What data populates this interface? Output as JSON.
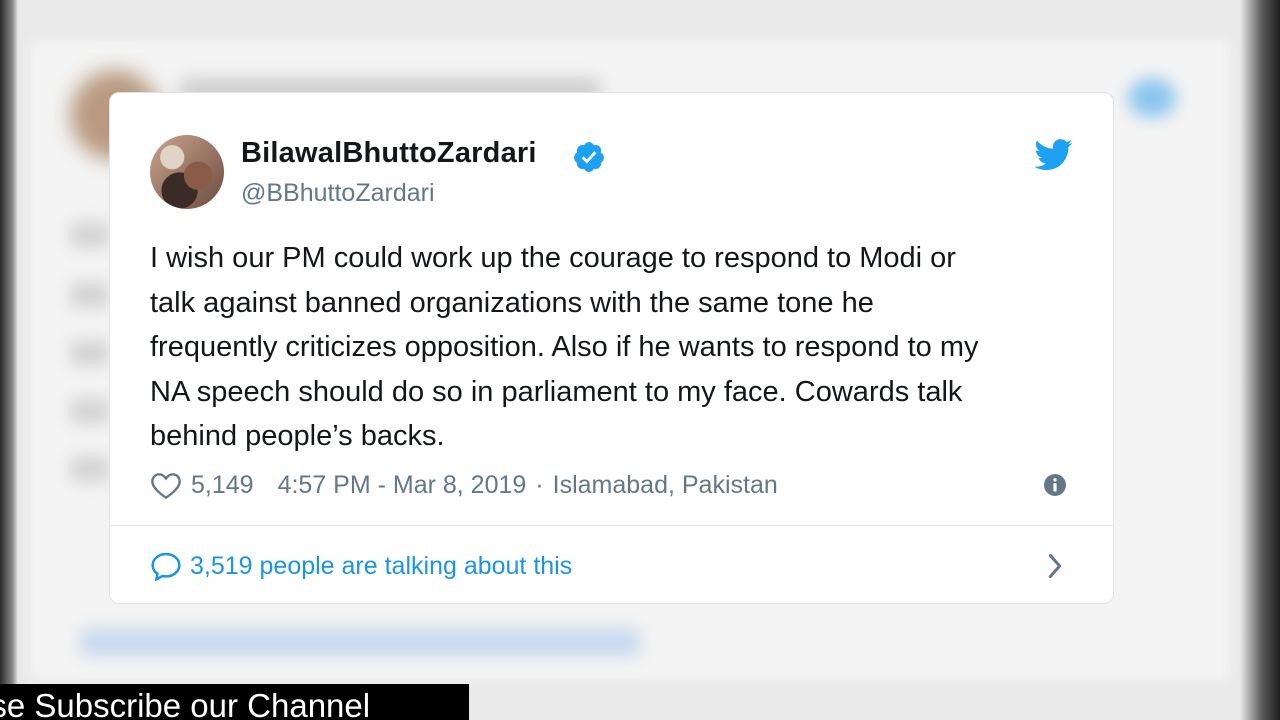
{
  "tweet": {
    "display_name": "BilawalBhuttoZardari",
    "handle": "@BBhuttoZardari",
    "verified_icon": "verified-badge-icon",
    "brand_icon": "twitter-bird-icon",
    "text_lines": [
      "I wish our PM could work up the courage to respond to Modi or",
      "talk against banned organizations with the same tone he",
      "frequently criticizes opposition. Also if he wants to respond to my",
      "NA speech should do so in parliament to my face. Cowards talk",
      "behind people’s backs."
    ],
    "likes": "5,149",
    "timestamp": "4:57 PM - Mar 8, 2019",
    "separator": "·",
    "location": "Islamabad, Pakistan",
    "talking": "3,519 people are talking about this"
  },
  "banner": {
    "text": "ase Subscribe our Channel"
  },
  "colors": {
    "link_blue": "#1b95e0",
    "twitter_blue": "#1da1f2",
    "muted_gray": "#657786",
    "text_dark": "#14171a"
  }
}
